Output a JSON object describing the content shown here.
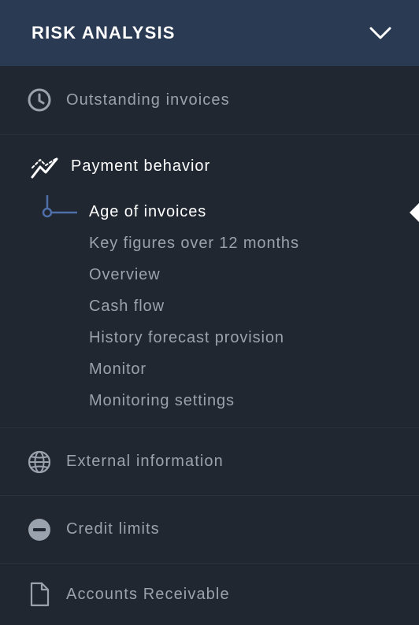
{
  "header": {
    "title": "RISK ANALYSIS"
  },
  "sections": {
    "outstanding": {
      "label": "Outstanding invoices",
      "icon": "clock-icon"
    },
    "payment": {
      "label": "Payment behavior",
      "icon": "trend-chart-icon",
      "items": [
        "Age of invoices",
        "Key figures over 12 months",
        "Overview",
        "Cash flow",
        "History forecast provision",
        "Monitor",
        "Monitoring settings"
      ],
      "active_item": "Age of invoices"
    },
    "external": {
      "label": "External information",
      "icon": "globe-icon"
    },
    "credit": {
      "label": "Credit limits",
      "icon": "minus-circle-icon"
    },
    "receivable": {
      "label": "Accounts Receivable",
      "icon": "document-icon"
    }
  },
  "colors": {
    "header_bg": "#2b3a53",
    "panel_bg": "#202731",
    "muted_text": "#9aa2ad",
    "active_text": "#ffffff",
    "tree_line": "#4f6fa8"
  }
}
